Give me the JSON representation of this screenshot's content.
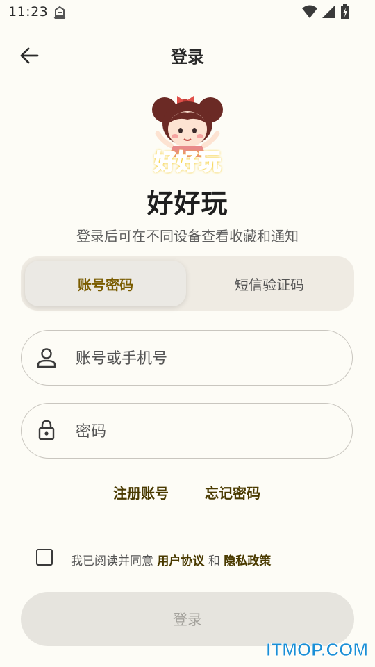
{
  "status_bar": {
    "time": "11:23"
  },
  "app_bar": {
    "title": "登录",
    "back_icon": "arrow-left-icon"
  },
  "logo": {
    "characters": [
      "好",
      "好",
      "玩"
    ],
    "character_colors": [
      "#f4a300",
      "#e8418a",
      "#2fa4e7"
    ]
  },
  "app_name": "好好玩",
  "subtitle": "登录后可在不同设备查看收藏和通知",
  "tabs": [
    {
      "label": "账号密码",
      "active": true
    },
    {
      "label": "短信验证码",
      "active": false
    }
  ],
  "account_field": {
    "placeholder": "账号或手机号",
    "value": "",
    "icon": "person-icon"
  },
  "password_field": {
    "placeholder": "密码",
    "value": "",
    "icon": "lock-icon"
  },
  "links": {
    "register": "注册账号",
    "forgot": "忘记密码"
  },
  "agreement": {
    "checked": false,
    "prefix": "我已阅读并同意",
    "user_agreement": "用户协议",
    "and": "和",
    "privacy_policy": "隐私政策"
  },
  "login_button": {
    "label": "登录"
  },
  "watermark": "ITMOP.COM",
  "colors": {
    "background": "#fdfcf6",
    "accent_text": "#7a5c00",
    "link_text": "#4a3a00",
    "button_disabled_bg": "#e6e4de",
    "watermark": "#1a8fd6"
  }
}
